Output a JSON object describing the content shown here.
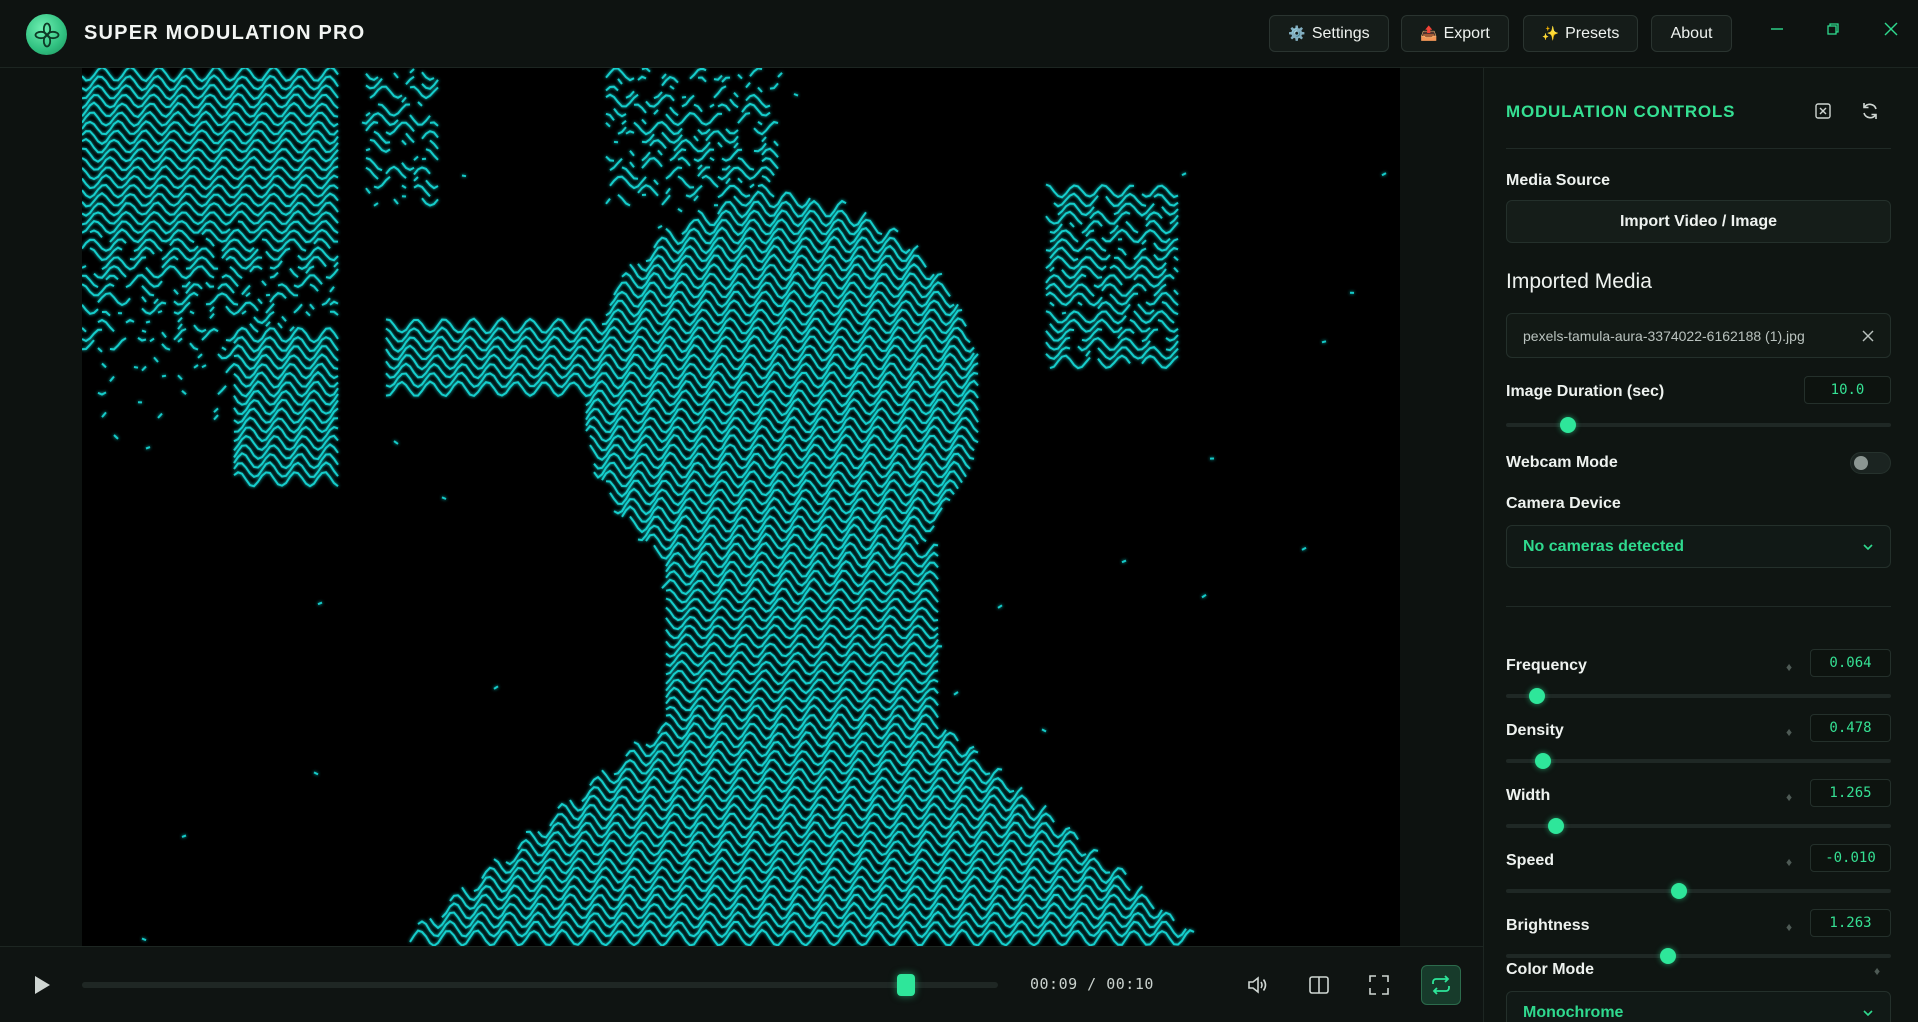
{
  "app": {
    "title": "SUPER MODULATION PRO"
  },
  "header": {
    "settings_label": "Settings",
    "settings_icon": "⚙️",
    "export_label": "Export",
    "export_icon": "📤",
    "presets_label": "Presets",
    "presets_icon": "✨",
    "about_label": "About"
  },
  "player": {
    "time_display": "00:09 / 00:10",
    "progress": 0.9
  },
  "panel": {
    "title": "MODULATION CONTROLS",
    "media_source_label": "Media Source",
    "import_button_label": "Import Video / Image",
    "imported_media_heading": "Imported Media",
    "imported_file_name": "pexels-tamula-aura-3374022-6162188 (1).jpg",
    "image_duration_label": "Image Duration (sec)",
    "image_duration_value": "10.0",
    "image_duration_level": 0.16,
    "webcam_mode_label": "Webcam Mode",
    "webcam_mode_on": false,
    "camera_device_label": "Camera Device",
    "camera_device_value": "No cameras detected",
    "params": [
      {
        "label": "Frequency",
        "value": "0.064",
        "level": 0.08
      },
      {
        "label": "Density",
        "value": "0.478",
        "level": 0.095
      },
      {
        "label": "Width",
        "value": "1.265",
        "level": 0.13
      },
      {
        "label": "Speed",
        "value": "-0.010",
        "level": 0.45
      },
      {
        "label": "Brightness",
        "value": "1.263",
        "level": 0.42
      }
    ],
    "color_mode_label": "Color Mode",
    "color_mode_value": "Monochrome"
  },
  "colors": {
    "accent": "#2ee69a",
    "wave": "#19e3e0",
    "background": "#0c100e"
  }
}
